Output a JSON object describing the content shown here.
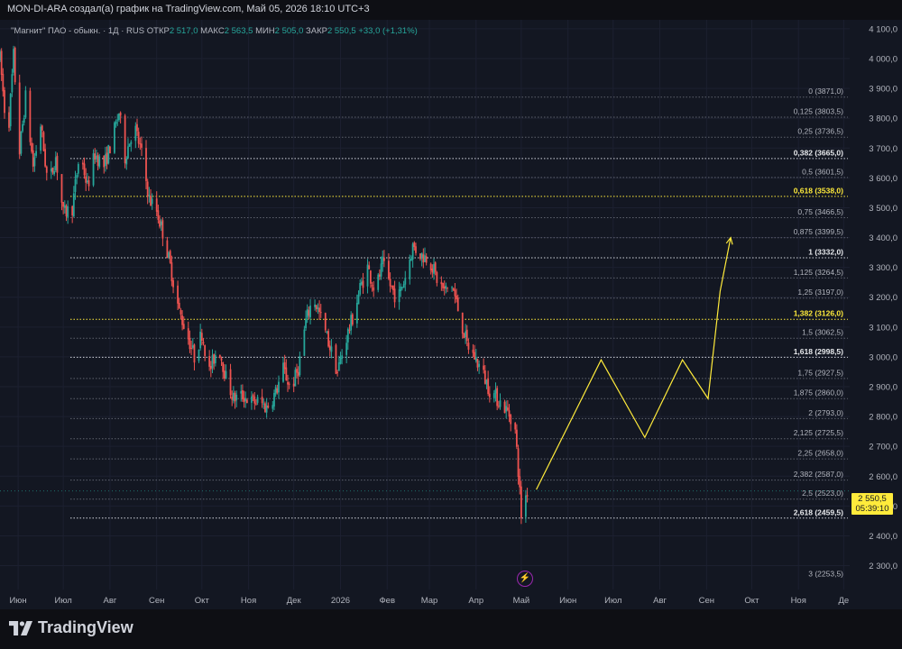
{
  "caption": "MON-DI-ARA создал(а) график на TradingView.com, Май 05, 2026 18:10 UTC+3",
  "legend": {
    "symbol": "\"Магнит\" ПАО - обыкн. · 1Д · RUS",
    "open_label": "ОТКР",
    "open": "2 517,0",
    "high_label": "МАКС",
    "high": "2 563,5",
    "low_label": "МИН",
    "low": "2 505,0",
    "close_label": "ЗАКР",
    "close": "2 550,5",
    "change": "+33,0 (+1,31%)"
  },
  "price_tag": {
    "price": "2 550,5",
    "timer": "05:39:10"
  },
  "brand": "TradingView",
  "colors": {
    "background": "#131722",
    "up": "#26a69a",
    "down": "#ef5350",
    "fib_line": "#787b86",
    "fib_highlight": "#ffeb3b",
    "projection": "#ffeb3b"
  },
  "icons": {
    "alert": "lightning-icon",
    "logo": "tradingview-logo-icon"
  },
  "chart_data": {
    "type": "candlestick",
    "title": "",
    "y_axis": {
      "ticks": [
        "4 100,0",
        "4 000,0",
        "3 900,0",
        "3 800,0",
        "3 700,0",
        "3 600,0",
        "3 500,0",
        "3 400,0",
        "3 300,0",
        "3 200,0",
        "3 100,0",
        "3 000,0",
        "2 900,0",
        "2 800,0",
        "2 700,0",
        "2 600,0",
        "2 500,0",
        "2 400,0",
        "2 300,0"
      ],
      "tick_values": [
        4100,
        4000,
        3900,
        3800,
        3700,
        3600,
        3500,
        3400,
        3300,
        3200,
        3100,
        3000,
        2900,
        2800,
        2700,
        2600,
        2500,
        2400,
        2300
      ],
      "range": [
        2220,
        4130
      ]
    },
    "x_axis": {
      "ticks": [
        "Июн",
        "Июл",
        "Авг",
        "Сен",
        "Окт",
        "Ноя",
        "Дек",
        "2026",
        "Фев",
        "Мар",
        "Апр",
        "Май",
        "Июн",
        "Июл",
        "Авг",
        "Сен",
        "Окт",
        "Ноя",
        "Де"
      ],
      "range": [
        "2025-05-20",
        "2026-12-05"
      ]
    },
    "fibonacci": [
      {
        "ratio": "0",
        "price": "3871,0",
        "value": 3871.0,
        "style": "normal"
      },
      {
        "ratio": "0,125",
        "price": "3803,5",
        "value": 3803.5,
        "style": "normal"
      },
      {
        "ratio": "0,25",
        "price": "3736,5",
        "value": 3736.5,
        "style": "normal"
      },
      {
        "ratio": "0,382",
        "price": "3665,0",
        "value": 3665.0,
        "style": "bold"
      },
      {
        "ratio": "0,5",
        "price": "3601,5",
        "value": 3601.5,
        "style": "normal"
      },
      {
        "ratio": "0,618",
        "price": "3538,0",
        "value": 3538.0,
        "style": "highlight"
      },
      {
        "ratio": "0,75",
        "price": "3466,5",
        "value": 3466.5,
        "style": "normal"
      },
      {
        "ratio": "0,875",
        "price": "3399,5",
        "value": 3399.5,
        "style": "normal"
      },
      {
        "ratio": "1",
        "price": "3332,0",
        "value": 3332.0,
        "style": "bold"
      },
      {
        "ratio": "1,125",
        "price": "3264,5",
        "value": 3264.5,
        "style": "normal"
      },
      {
        "ratio": "1,25",
        "price": "3197,0",
        "value": 3197.0,
        "style": "normal"
      },
      {
        "ratio": "1,382",
        "price": "3126,0",
        "value": 3126.0,
        "style": "highlight"
      },
      {
        "ratio": "1,5",
        "price": "3062,5",
        "value": 3062.5,
        "style": "normal"
      },
      {
        "ratio": "1,618",
        "price": "2998,5",
        "value": 2998.5,
        "style": "bold"
      },
      {
        "ratio": "1,75",
        "price": "2927,5",
        "value": 2927.5,
        "style": "normal"
      },
      {
        "ratio": "1,875",
        "price": "2860,0",
        "value": 2860.0,
        "style": "normal"
      },
      {
        "ratio": "2",
        "price": "2793,0",
        "value": 2793.0,
        "style": "normal"
      },
      {
        "ratio": "2,125",
        "price": "2725,5",
        "value": 2725.5,
        "style": "normal"
      },
      {
        "ratio": "2,25",
        "price": "2658,0",
        "value": 2658.0,
        "style": "normal"
      },
      {
        "ratio": "2,382",
        "price": "2587,0",
        "value": 2587.0,
        "style": "normal"
      },
      {
        "ratio": "2,5",
        "price": "2523,0",
        "value": 2523.0,
        "style": "normal"
      },
      {
        "ratio": "2,618",
        "price": "2459,5",
        "value": 2459.5,
        "style": "bold"
      },
      {
        "ratio": "3",
        "price": "2253,5",
        "value": 2253.5,
        "style": "normal",
        "no_line": true
      }
    ],
    "price_path": [
      [
        "2025-05-20",
        4000
      ],
      [
        "2025-05-25",
        3720
      ],
      [
        "2025-05-29",
        4010
      ],
      [
        "2025-06-02",
        3690
      ],
      [
        "2025-06-06",
        3870
      ],
      [
        "2025-06-11",
        3640
      ],
      [
        "2025-06-16",
        3780
      ],
      [
        "2025-06-21",
        3570
      ],
      [
        "2025-06-26",
        3670
      ],
      [
        "2025-07-01",
        3480
      ],
      [
        "2025-07-07",
        3500
      ],
      [
        "2025-07-12",
        3690
      ],
      [
        "2025-07-17",
        3570
      ],
      [
        "2025-07-22",
        3680
      ],
      [
        "2025-07-28",
        3640
      ],
      [
        "2025-08-02",
        3720
      ],
      [
        "2025-08-07",
        3820
      ],
      [
        "2025-08-11",
        3670
      ],
      [
        "2025-08-17",
        3780
      ],
      [
        "2025-08-22",
        3680
      ],
      [
        "2025-08-27",
        3530
      ],
      [
        "2025-09-01",
        3490
      ],
      [
        "2025-09-06",
        3400
      ],
      [
        "2025-09-11",
        3280
      ],
      [
        "2025-09-16",
        3150
      ],
      [
        "2025-09-21",
        3080
      ],
      [
        "2025-09-26",
        3000
      ],
      [
        "2025-10-01",
        3080
      ],
      [
        "2025-10-06",
        2950
      ],
      [
        "2025-10-12",
        3040
      ],
      [
        "2025-10-17",
        2930
      ],
      [
        "2025-10-22",
        2860
      ],
      [
        "2025-10-28",
        2870
      ],
      [
        "2025-11-03",
        2850
      ],
      [
        "2025-11-08",
        2850
      ],
      [
        "2025-11-13",
        2830
      ],
      [
        "2025-11-19",
        2880
      ],
      [
        "2025-11-24",
        2960
      ],
      [
        "2025-11-29",
        2890
      ],
      [
        "2025-12-04",
        2960
      ],
      [
        "2025-12-09",
        3120
      ],
      [
        "2025-12-14",
        3200
      ],
      [
        "2025-12-19",
        3130
      ],
      [
        "2025-12-24",
        3050
      ],
      [
        "2025-12-30",
        2950
      ],
      [
        "2026-01-04",
        3050
      ],
      [
        "2026-01-09",
        3130
      ],
      [
        "2026-01-14",
        3230
      ],
      [
        "2026-01-19",
        3300
      ],
      [
        "2026-01-24",
        3220
      ],
      [
        "2026-01-29",
        3310
      ],
      [
        "2026-02-03",
        3240
      ],
      [
        "2026-02-08",
        3190
      ],
      [
        "2026-02-13",
        3270
      ],
      [
        "2026-02-18",
        3370
      ],
      [
        "2026-02-24",
        3340
      ],
      [
        "2026-03-01",
        3330
      ],
      [
        "2026-03-06",
        3260
      ],
      [
        "2026-03-11",
        3220
      ],
      [
        "2026-03-16",
        3240
      ],
      [
        "2026-03-21",
        3140
      ],
      [
        "2026-03-26",
        3040
      ],
      [
        "2026-03-31",
        3000
      ],
      [
        "2026-04-05",
        2950
      ],
      [
        "2026-04-10",
        2890
      ],
      [
        "2026-04-15",
        2860
      ],
      [
        "2026-04-20",
        2830
      ],
      [
        "2026-04-24",
        2800
      ],
      [
        "2026-04-27",
        2750
      ],
      [
        "2026-04-29",
        2620
      ],
      [
        "2026-05-01",
        2470
      ],
      [
        "2026-05-03",
        2520
      ],
      [
        "2026-05-05",
        2550
      ]
    ],
    "projection": [
      [
        "2026-05-11",
        2555
      ],
      [
        "2026-06-23",
        2990
      ],
      [
        "2026-07-22",
        2730
      ],
      [
        "2026-08-16",
        2990
      ],
      [
        "2026-09-02",
        2860
      ],
      [
        "2026-09-10",
        3220
      ],
      [
        "2026-09-17",
        3400
      ]
    ],
    "last_price": 2550.5
  }
}
